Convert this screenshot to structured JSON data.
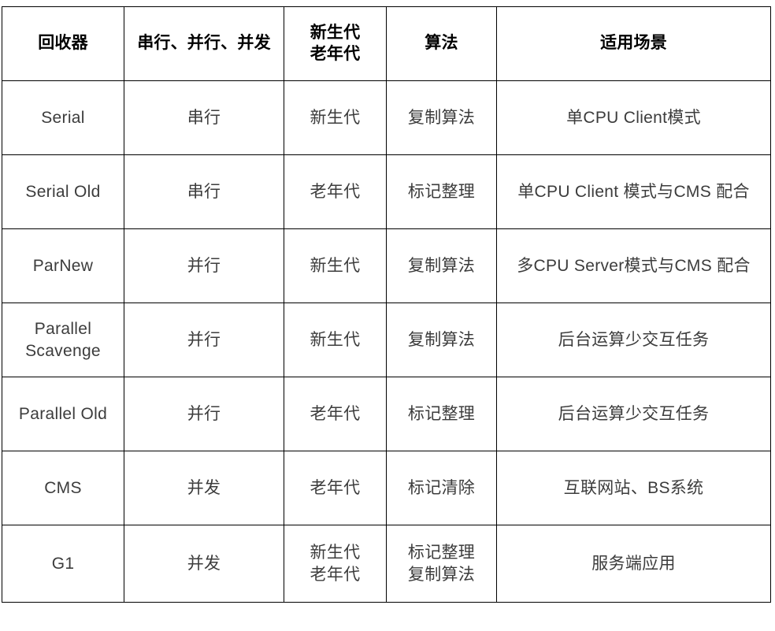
{
  "table": {
    "caption_visible": false,
    "columns": [
      "回收器",
      "串行、并行、并发",
      "新生代\n老年代",
      "算法",
      "适用场景"
    ],
    "rows": [
      {
        "collector": "Serial",
        "concurrency": "串行",
        "generation": "新生代",
        "algorithm": "复制算法",
        "scenario": "单CPU Client模式"
      },
      {
        "collector": "Serial Old",
        "concurrency": "串行",
        "generation": "老年代",
        "algorithm": "标记整理",
        "scenario": "单CPU Client 模式与CMS 配合"
      },
      {
        "collector": "ParNew",
        "concurrency": "并行",
        "generation": "新生代",
        "algorithm": "复制算法",
        "scenario": "多CPU Server模式与CMS 配合"
      },
      {
        "collector": "Parallel\nScavenge",
        "concurrency": "并行",
        "generation": "新生代",
        "algorithm": "复制算法",
        "scenario": "后台运算少交互任务"
      },
      {
        "collector": "Parallel Old",
        "concurrency": "并行",
        "generation": "老年代",
        "algorithm": "标记整理",
        "scenario": "后台运算少交互任务"
      },
      {
        "collector": "CMS",
        "concurrency": "并发",
        "generation": "老年代",
        "algorithm": "标记清除",
        "scenario": "互联网站、BS系统"
      },
      {
        "collector": "G1",
        "concurrency": "并发",
        "generation": "新生代\n老年代",
        "algorithm": "标记整理\n复制算法",
        "scenario": "服务端应用"
      }
    ]
  },
  "colors": {
    "border": "#000000",
    "header_text": "#000000",
    "body_text": "#3c3c3c",
    "background": "#ffffff"
  }
}
